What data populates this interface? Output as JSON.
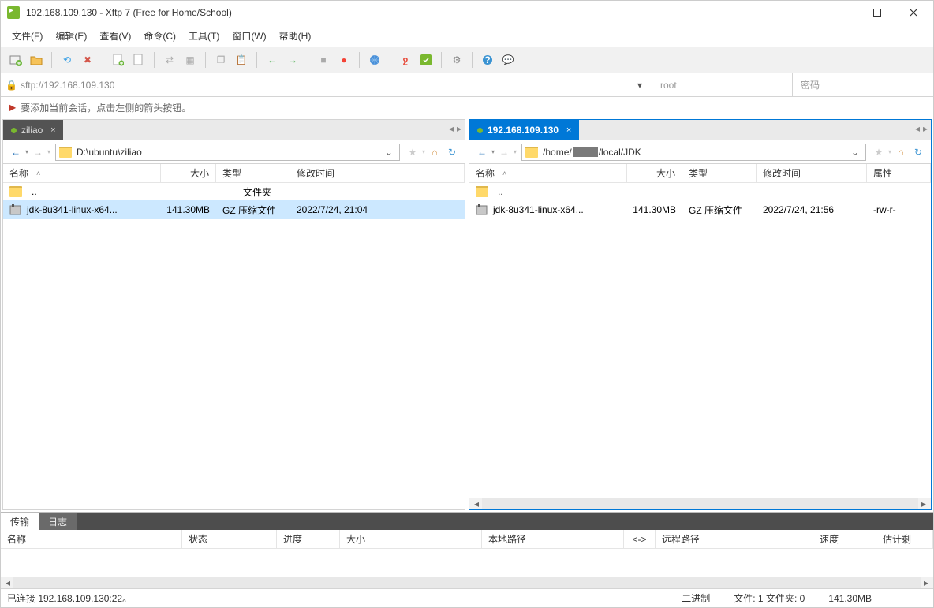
{
  "window": {
    "title": "192.168.109.130 - Xftp 7 (Free for Home/School)"
  },
  "menu": {
    "file": "文件(F)",
    "edit": "编辑(E)",
    "view": "查看(V)",
    "command": "命令(C)",
    "tools": "工具(T)",
    "window": "窗口(W)",
    "help": "帮助(H)"
  },
  "addr": {
    "url": "sftp://192.168.109.130",
    "user": "root",
    "pass_placeholder": "密码"
  },
  "hint": "要添加当前会话，点击左侧的箭头按钮。",
  "left": {
    "tab": "ziliao",
    "path": "D:\\ubuntu\\ziliao",
    "cols": {
      "name": "名称",
      "size": "大小",
      "type": "类型",
      "modified": "修改时间"
    },
    "parent": {
      "name": "..",
      "type": "文件夹"
    },
    "row": {
      "name": "jdk-8u341-linux-x64...",
      "size": "141.30MB",
      "type": "GZ 压缩文件",
      "modified": "2022/7/24, 21:04"
    }
  },
  "right": {
    "tab": "192.168.109.130",
    "path_pre": "/home/",
    "path_post": "/local/JDK",
    "cols": {
      "name": "名称",
      "size": "大小",
      "type": "类型",
      "modified": "修改时间",
      "attr": "属性"
    },
    "parent": {
      "name": ".."
    },
    "row": {
      "name": "jdk-8u341-linux-x64...",
      "size": "141.30MB",
      "type": "GZ 压缩文件",
      "modified": "2022/7/24, 21:56",
      "attr": "-rw-r-"
    }
  },
  "bottom": {
    "tabs": {
      "transfer": "传输",
      "log": "日志"
    },
    "cols": {
      "name": "名称",
      "status": "状态",
      "progress": "进度",
      "size": "大小",
      "localpath": "本地路径",
      "arrow": "<->",
      "remotepath": "远程路径",
      "speed": "速度",
      "eta": "估计剩"
    }
  },
  "status": {
    "conn": "已连接 192.168.109.130:22。",
    "binary": "二进制",
    "count": "文件: 1 文件夹: 0",
    "totalsize": "141.30MB"
  }
}
